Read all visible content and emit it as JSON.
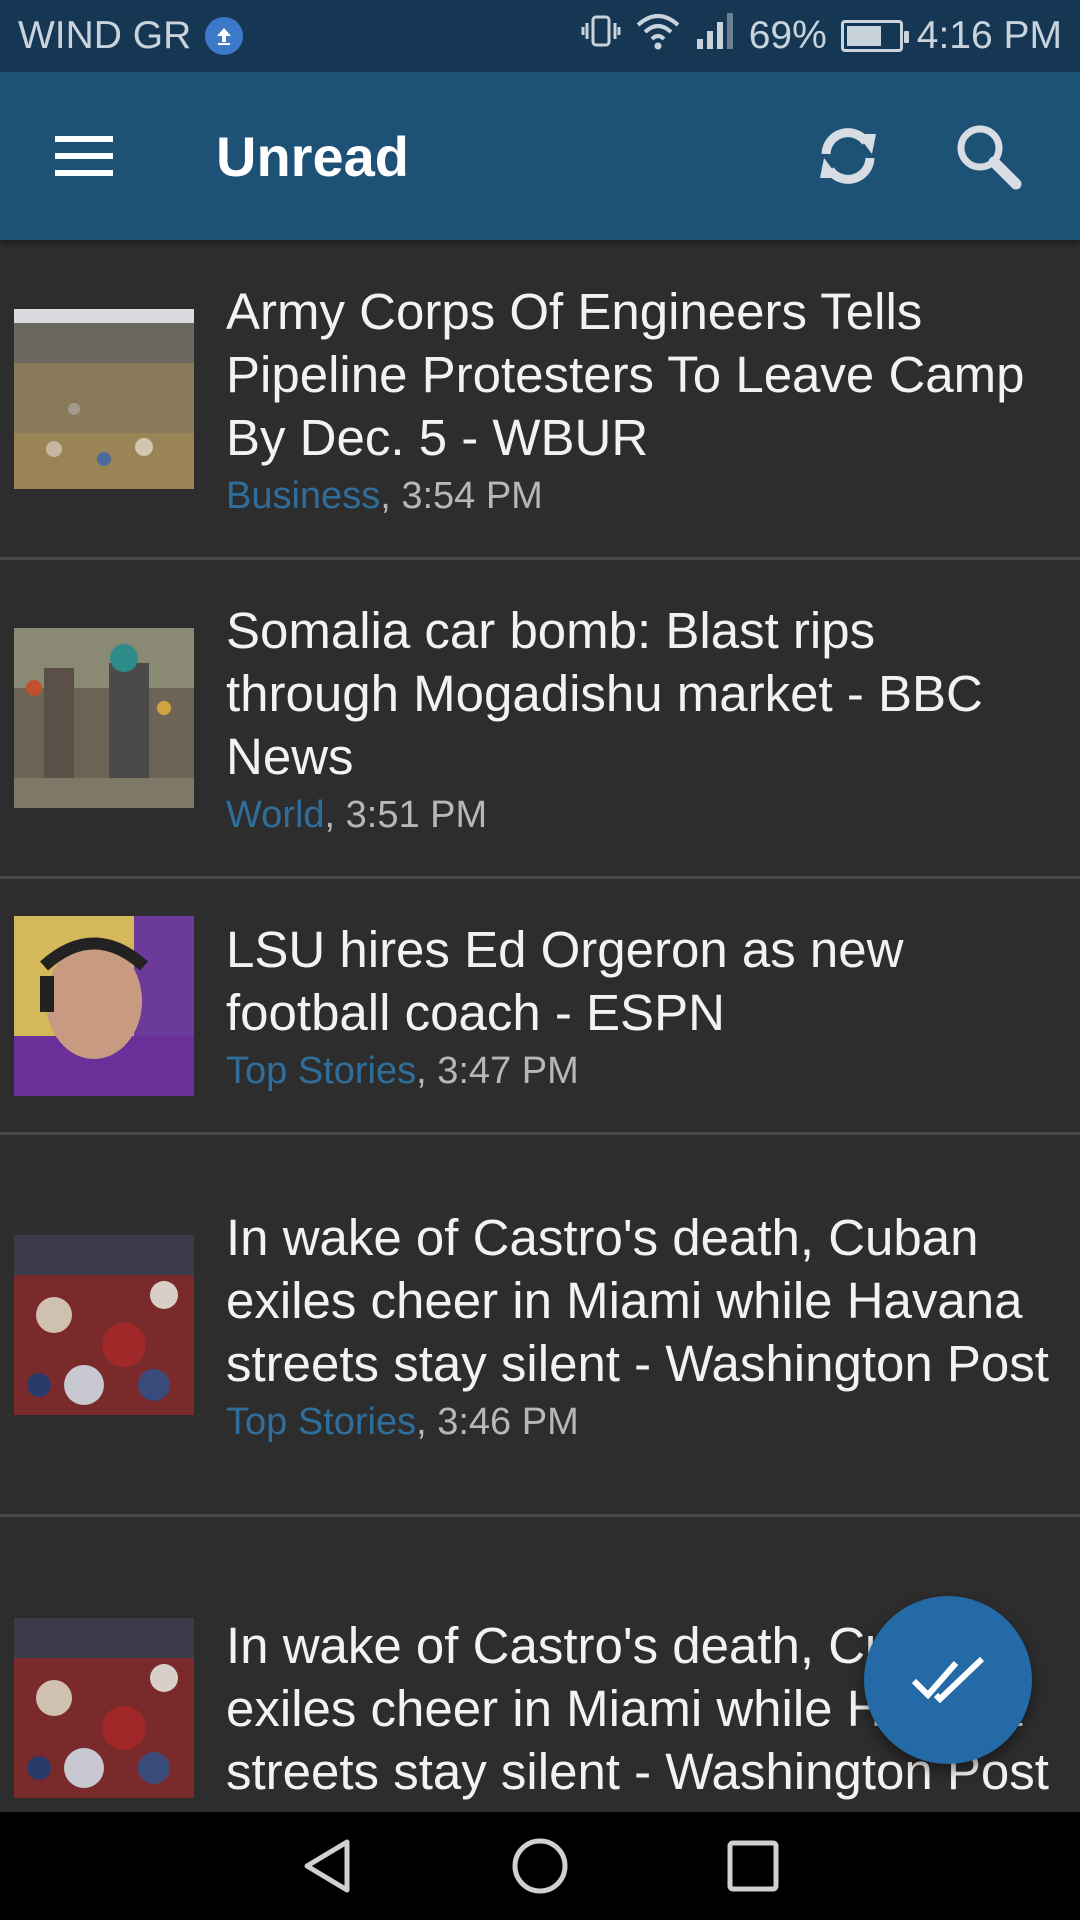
{
  "status_bar": {
    "carrier": "WIND GR",
    "battery_percent": "69%",
    "battery_level": 0.69,
    "time": "4:16 PM"
  },
  "app_bar": {
    "title": "Unread",
    "icons": [
      "menu-icon",
      "refresh-icon",
      "search-icon"
    ]
  },
  "articles": [
    {
      "title": "Army Corps Of Engineers Tells Pipeline Protesters To Leave Camp By Dec. 5 - WBUR",
      "category": "Business",
      "time": ", 3:54 PM"
    },
    {
      "title": "Somalia car bomb: Blast rips through Mogadishu market - BBC News",
      "category": "World",
      "time": ", 3:51 PM"
    },
    {
      "title": "LSU hires Ed Orgeron as new football coach - ESPN",
      "category": "Top Stories",
      "time": ", 3:47 PM"
    },
    {
      "title": "In wake of Castro's death, Cuban exiles cheer in Miami while Havana streets stay silent - Washington Post",
      "category": "Top Stories",
      "time": ", 3:46 PM"
    },
    {
      "title": "In wake of Castro's death, Cuban exiles cheer in Miami while Havana streets stay silent - Washington Post",
      "category": "",
      "time": ""
    }
  ],
  "fab": {
    "icon": "double-check-icon"
  },
  "nav": {
    "icons": [
      "back-icon",
      "home-icon",
      "recents-icon"
    ]
  },
  "colors": {
    "status_bar": "#163754",
    "app_bar": "#1d5176",
    "background": "#2d2d2d",
    "category": "#2f6e9b",
    "fab": "#246aa6"
  }
}
